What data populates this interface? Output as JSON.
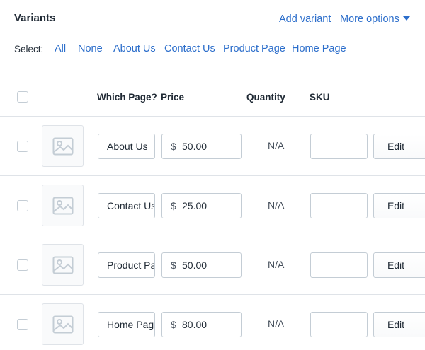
{
  "header": {
    "title": "Variants",
    "add_variant": "Add variant",
    "more_options": "More options"
  },
  "select": {
    "label": "Select:",
    "options": [
      "All",
      "None",
      "About Us",
      "Contact Us",
      "Product Page",
      "Home Page"
    ]
  },
  "table": {
    "columns": {
      "which_page": "Which Page?",
      "price": "Price",
      "quantity": "Quantity",
      "sku": "SKU"
    },
    "currency_symbol": "$",
    "edit_label": "Edit",
    "rows": [
      {
        "page": "About Us",
        "price": "50.00",
        "quantity": "N/A",
        "sku": ""
      },
      {
        "page": "Contact Us",
        "price": "25.00",
        "quantity": "N/A",
        "sku": ""
      },
      {
        "page": "Product Page",
        "price": "50.00",
        "quantity": "N/A",
        "sku": ""
      },
      {
        "page": "Home Page",
        "price": "80.00",
        "quantity": "N/A",
        "sku": ""
      }
    ]
  },
  "colors": {
    "link": "#2c6ecb",
    "border": "#dfe3e8",
    "text": "#212b36"
  },
  "icons": {
    "thumbnail": "image-placeholder-icon",
    "dropdown": "caret-down-icon"
  }
}
